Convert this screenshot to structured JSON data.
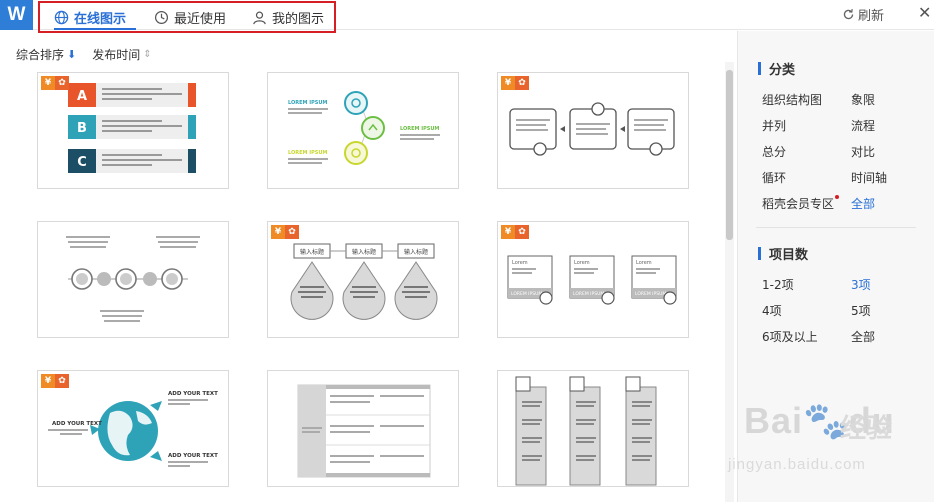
{
  "app": {
    "logo_letter": "W"
  },
  "tabs": [
    {
      "label": "在线图示",
      "icon": "globe-icon",
      "active": true
    },
    {
      "label": "最近使用",
      "icon": "clock-icon",
      "active": false
    },
    {
      "label": "我的图示",
      "icon": "user-icon",
      "active": false
    }
  ],
  "toolbar": {
    "refresh_label": "刷新",
    "close_glyph": "✕"
  },
  "sort": {
    "composite_label": "综合排序",
    "composite_arrow": "⬇",
    "time_label": "发布时间",
    "time_arrow": "⇕"
  },
  "badges": {
    "yen": "¥",
    "leaf": "✿"
  },
  "templates": [
    {
      "id": "t1",
      "premium": true,
      "style": "abc-list",
      "texts": {
        "a": "A",
        "b": "B",
        "c": "C"
      }
    },
    {
      "id": "t2",
      "premium": false,
      "style": "circle-flow",
      "texts": {
        "lorem": "LOREM IPSUM"
      }
    },
    {
      "id": "t3",
      "premium": true,
      "style": "three-boxes"
    },
    {
      "id": "t4",
      "premium": false,
      "style": "circle-timeline"
    },
    {
      "id": "t5",
      "premium": true,
      "style": "drops",
      "texts": {
        "input_title": "输入标题"
      }
    },
    {
      "id": "t6",
      "premium": true,
      "style": "search-cards",
      "texts": {
        "lorem": "Lorem",
        "footer": "LOREM IPSUM"
      }
    },
    {
      "id": "t7",
      "premium": true,
      "style": "globe",
      "texts": {
        "add_your_text": "ADD YOUR TEXT"
      }
    },
    {
      "id": "t8",
      "premium": false,
      "style": "table"
    },
    {
      "id": "t9",
      "premium": false,
      "style": "columns"
    }
  ],
  "sidebar": {
    "category_title": "分类",
    "categories": [
      {
        "label": "组织结构图"
      },
      {
        "label": "象限"
      },
      {
        "label": "并列"
      },
      {
        "label": "流程"
      },
      {
        "label": "总分"
      },
      {
        "label": "对比"
      },
      {
        "label": "循环"
      },
      {
        "label": "时间轴"
      },
      {
        "label": "稻壳会员专区",
        "new_dot": true
      },
      {
        "label": "全部",
        "selected": true
      }
    ],
    "count_title": "项目数",
    "counts": [
      {
        "label": "1-2项"
      },
      {
        "label": "3项",
        "selected": true
      },
      {
        "label": "4项"
      },
      {
        "label": "5项"
      },
      {
        "label": "6项及以上"
      },
      {
        "label": "全部"
      }
    ]
  },
  "watermark": {
    "brand": "Bai",
    "brand2": "du",
    "cn": "经验",
    "url": "jingyan.baidu.com"
  },
  "colors": {
    "accent": "#2a6fd6",
    "highlight_border": "#d51f25",
    "premium_orange": "#f08a24"
  }
}
